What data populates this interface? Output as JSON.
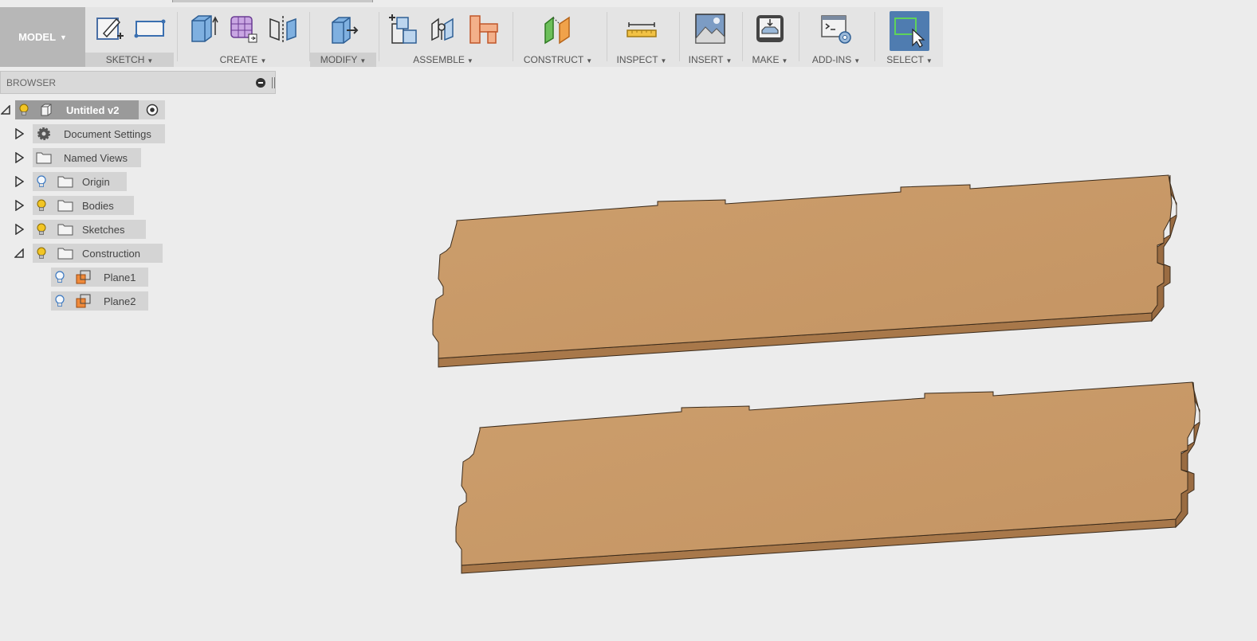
{
  "toolbar": {
    "workspace": "MODEL",
    "groups": {
      "sketch": "SKETCH",
      "create": "CREATE",
      "modify": "MODIFY",
      "assemble": "ASSEMBLE",
      "construct": "CONSTRUCT",
      "inspect": "INSPECT",
      "insert": "INSERT",
      "make": "MAKE",
      "addins": "ADD-INS",
      "select": "SELECT"
    },
    "active_group": "modify",
    "icons": {
      "sketch": [
        "create-sketch-icon",
        "rectangle-icon"
      ],
      "create": [
        "extrude-icon",
        "form-icon",
        "mirror-icon"
      ],
      "modify": [
        "press-pull-icon"
      ],
      "assemble": [
        "new-component-icon",
        "joint-icon",
        "as-built-joint-icon"
      ],
      "construct": [
        "offset-plane-icon"
      ],
      "inspect": [
        "measure-icon"
      ],
      "insert": [
        "insert-image-icon"
      ],
      "make": [
        "3d-print-icon"
      ],
      "addins": [
        "scripts-addins-icon"
      ],
      "select": [
        "window-select-icon"
      ]
    }
  },
  "browser": {
    "title": "BROWSER",
    "root": {
      "label": "Untitled v2"
    },
    "items": [
      {
        "label": "Document Settings",
        "icon": "gear-icon"
      },
      {
        "label": "Named Views",
        "icon": "folder-icon"
      },
      {
        "label": "Origin",
        "icon": "folder-icon",
        "bulb": "off"
      },
      {
        "label": "Bodies",
        "icon": "folder-icon",
        "bulb": "on"
      },
      {
        "label": "Sketches",
        "icon": "folder-icon",
        "bulb": "on"
      },
      {
        "label": "Construction",
        "icon": "folder-icon",
        "bulb": "on",
        "expanded": true
      }
    ],
    "construction_children": [
      {
        "label": "Plane1",
        "icon": "plane-icon",
        "bulb": "off"
      },
      {
        "label": "Plane2",
        "icon": "plane-icon",
        "bulb": "off"
      }
    ]
  },
  "colors": {
    "board_top": "#c99b6a",
    "board_edge": "#a9784a",
    "background": "#ececec",
    "select_blue": "#4f7cb0"
  }
}
